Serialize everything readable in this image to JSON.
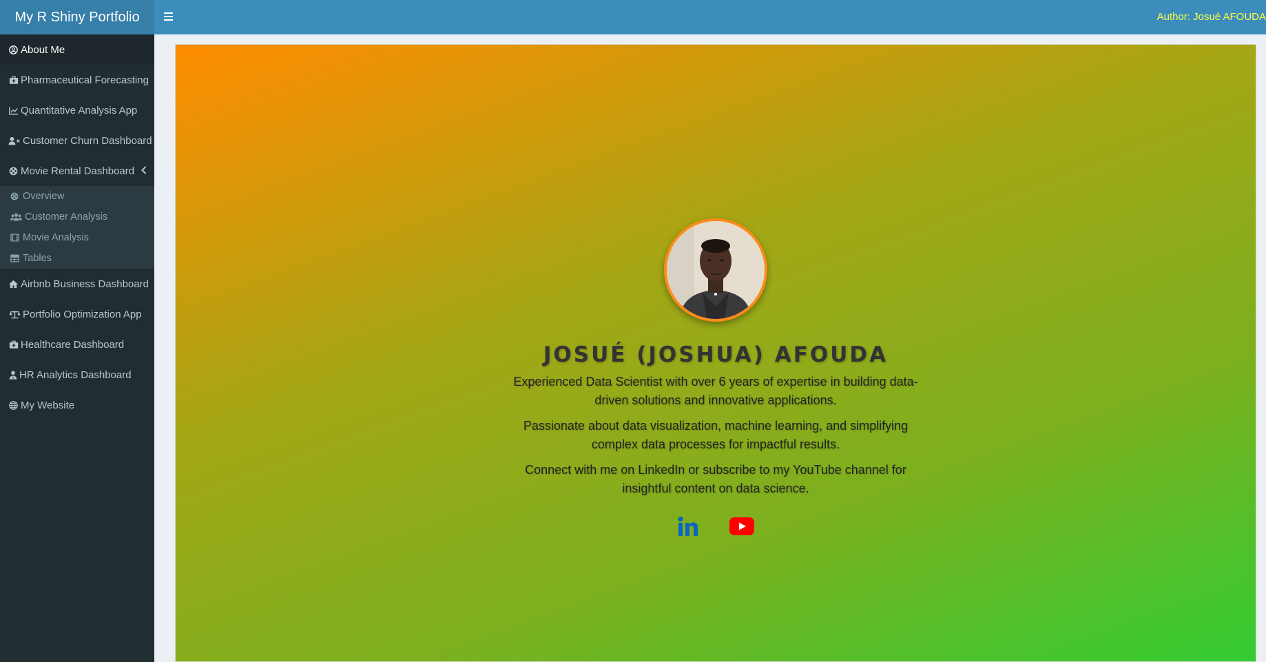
{
  "app": {
    "title": "My R Shiny Portfolio"
  },
  "header": {
    "author": "Author: Josué AFOUDA"
  },
  "sidebar": {
    "items": [
      {
        "label": "About Me",
        "icon": "user-circle-icon"
      },
      {
        "label": "Pharmaceutical Forecasting",
        "icon": "briefcase-medical-icon"
      },
      {
        "label": "Quantitative Analysis App",
        "icon": "line-chart-icon"
      },
      {
        "label": "Customer Churn Dashboard",
        "icon": "user-times-icon"
      },
      {
        "label": "Movie Rental Dashboard",
        "icon": "film-reel-icon"
      },
      {
        "label": "Airbnb Business Dashboard",
        "icon": "home-icon"
      },
      {
        "label": "Portfolio Optimization App",
        "icon": "balance-scale-icon"
      },
      {
        "label": "Healthcare Dashboard",
        "icon": "medkit-icon"
      },
      {
        "label": "HR Analytics Dashboard",
        "icon": "user-tie-icon"
      },
      {
        "label": "My Website",
        "icon": "globe-icon"
      }
    ],
    "submenu": [
      {
        "label": "Overview",
        "icon": "film-reel-icon"
      },
      {
        "label": "Customer Analysis",
        "icon": "users-icon"
      },
      {
        "label": "Movie Analysis",
        "icon": "film-icon"
      },
      {
        "label": "Tables",
        "icon": "table-icon"
      }
    ]
  },
  "profile": {
    "name": "JOSUÉ (JOSHUA) AFOUDA",
    "para1": "Experienced Data Scientist with over 6 years of expertise in building data-driven solutions and innovative applications.",
    "para2": "Passionate about data visualization, machine learning, and simplifying complex data processes for impactful results.",
    "para3": "Connect with me on LinkedIn or subscribe to my YouTube channel for insightful content on data science."
  },
  "colors": {
    "header": "#3c8dbc",
    "brand": "#367fa9",
    "sidebar": "#222d32",
    "author_text": "#ffff44",
    "linkedin": "#0a66c2",
    "youtube": "#ff0000"
  }
}
